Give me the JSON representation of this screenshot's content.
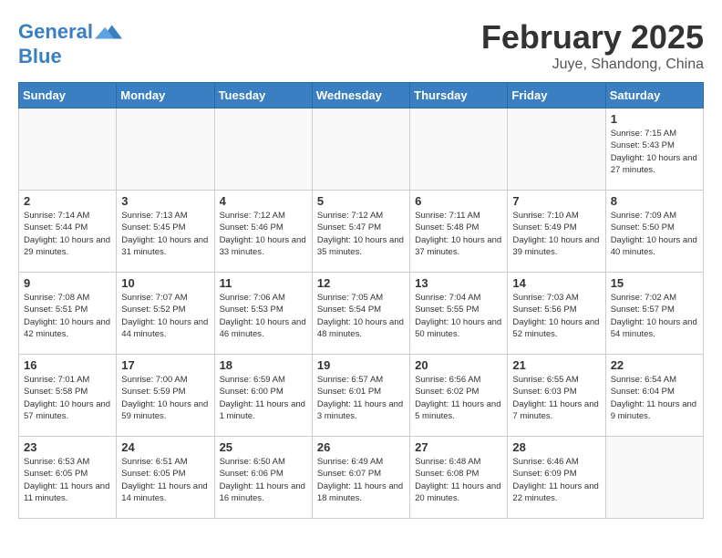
{
  "header": {
    "logo_line1": "General",
    "logo_line2": "Blue",
    "month_title": "February 2025",
    "location": "Juye, Shandong, China"
  },
  "weekdays": [
    "Sunday",
    "Monday",
    "Tuesday",
    "Wednesday",
    "Thursday",
    "Friday",
    "Saturday"
  ],
  "weeks": [
    [
      {
        "day": "",
        "info": ""
      },
      {
        "day": "",
        "info": ""
      },
      {
        "day": "",
        "info": ""
      },
      {
        "day": "",
        "info": ""
      },
      {
        "day": "",
        "info": ""
      },
      {
        "day": "",
        "info": ""
      },
      {
        "day": "1",
        "info": "Sunrise: 7:15 AM\nSunset: 5:43 PM\nDaylight: 10 hours and 27 minutes."
      }
    ],
    [
      {
        "day": "2",
        "info": "Sunrise: 7:14 AM\nSunset: 5:44 PM\nDaylight: 10 hours and 29 minutes."
      },
      {
        "day": "3",
        "info": "Sunrise: 7:13 AM\nSunset: 5:45 PM\nDaylight: 10 hours and 31 minutes."
      },
      {
        "day": "4",
        "info": "Sunrise: 7:12 AM\nSunset: 5:46 PM\nDaylight: 10 hours and 33 minutes."
      },
      {
        "day": "5",
        "info": "Sunrise: 7:12 AM\nSunset: 5:47 PM\nDaylight: 10 hours and 35 minutes."
      },
      {
        "day": "6",
        "info": "Sunrise: 7:11 AM\nSunset: 5:48 PM\nDaylight: 10 hours and 37 minutes."
      },
      {
        "day": "7",
        "info": "Sunrise: 7:10 AM\nSunset: 5:49 PM\nDaylight: 10 hours and 39 minutes."
      },
      {
        "day": "8",
        "info": "Sunrise: 7:09 AM\nSunset: 5:50 PM\nDaylight: 10 hours and 40 minutes."
      }
    ],
    [
      {
        "day": "9",
        "info": "Sunrise: 7:08 AM\nSunset: 5:51 PM\nDaylight: 10 hours and 42 minutes."
      },
      {
        "day": "10",
        "info": "Sunrise: 7:07 AM\nSunset: 5:52 PM\nDaylight: 10 hours and 44 minutes."
      },
      {
        "day": "11",
        "info": "Sunrise: 7:06 AM\nSunset: 5:53 PM\nDaylight: 10 hours and 46 minutes."
      },
      {
        "day": "12",
        "info": "Sunrise: 7:05 AM\nSunset: 5:54 PM\nDaylight: 10 hours and 48 minutes."
      },
      {
        "day": "13",
        "info": "Sunrise: 7:04 AM\nSunset: 5:55 PM\nDaylight: 10 hours and 50 minutes."
      },
      {
        "day": "14",
        "info": "Sunrise: 7:03 AM\nSunset: 5:56 PM\nDaylight: 10 hours and 52 minutes."
      },
      {
        "day": "15",
        "info": "Sunrise: 7:02 AM\nSunset: 5:57 PM\nDaylight: 10 hours and 54 minutes."
      }
    ],
    [
      {
        "day": "16",
        "info": "Sunrise: 7:01 AM\nSunset: 5:58 PM\nDaylight: 10 hours and 57 minutes."
      },
      {
        "day": "17",
        "info": "Sunrise: 7:00 AM\nSunset: 5:59 PM\nDaylight: 10 hours and 59 minutes."
      },
      {
        "day": "18",
        "info": "Sunrise: 6:59 AM\nSunset: 6:00 PM\nDaylight: 11 hours and 1 minute."
      },
      {
        "day": "19",
        "info": "Sunrise: 6:57 AM\nSunset: 6:01 PM\nDaylight: 11 hours and 3 minutes."
      },
      {
        "day": "20",
        "info": "Sunrise: 6:56 AM\nSunset: 6:02 PM\nDaylight: 11 hours and 5 minutes."
      },
      {
        "day": "21",
        "info": "Sunrise: 6:55 AM\nSunset: 6:03 PM\nDaylight: 11 hours and 7 minutes."
      },
      {
        "day": "22",
        "info": "Sunrise: 6:54 AM\nSunset: 6:04 PM\nDaylight: 11 hours and 9 minutes."
      }
    ],
    [
      {
        "day": "23",
        "info": "Sunrise: 6:53 AM\nSunset: 6:05 PM\nDaylight: 11 hours and 11 minutes."
      },
      {
        "day": "24",
        "info": "Sunrise: 6:51 AM\nSunset: 6:05 PM\nDaylight: 11 hours and 14 minutes."
      },
      {
        "day": "25",
        "info": "Sunrise: 6:50 AM\nSunset: 6:06 PM\nDaylight: 11 hours and 16 minutes."
      },
      {
        "day": "26",
        "info": "Sunrise: 6:49 AM\nSunset: 6:07 PM\nDaylight: 11 hours and 18 minutes."
      },
      {
        "day": "27",
        "info": "Sunrise: 6:48 AM\nSunset: 6:08 PM\nDaylight: 11 hours and 20 minutes."
      },
      {
        "day": "28",
        "info": "Sunrise: 6:46 AM\nSunset: 6:09 PM\nDaylight: 11 hours and 22 minutes."
      },
      {
        "day": "",
        "info": ""
      }
    ]
  ]
}
